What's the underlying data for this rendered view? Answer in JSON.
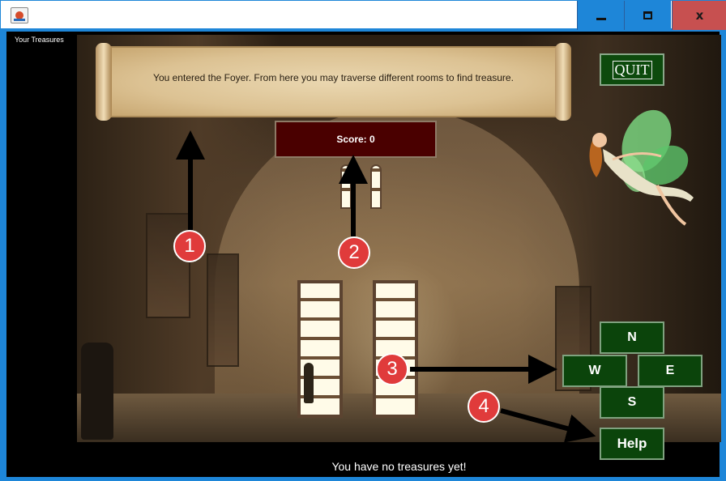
{
  "window": {
    "controls": {
      "minimize": "–",
      "maximize": "□",
      "close": "x"
    },
    "icons": {
      "app": "java-app-icon"
    }
  },
  "game": {
    "treasures_label": "Your Treasures",
    "message": "You entered the Foyer. From here you may traverse different rooms to find treasure.",
    "score": "Score: 0",
    "quit_label": "QUIT",
    "directions": {
      "north": "N",
      "west": "W",
      "east": "E",
      "south": "S"
    },
    "help_label": "Help",
    "status": "You have no treasures yet!"
  },
  "annotations": {
    "markers": [
      "1",
      "2",
      "3",
      "4"
    ]
  },
  "colors": {
    "titlebar_accent": "#1e86d8",
    "close_button": "#c75050",
    "button_green": "#0b440b",
    "score_bg": "#4a0000",
    "marker_red": "#e03b3b"
  }
}
